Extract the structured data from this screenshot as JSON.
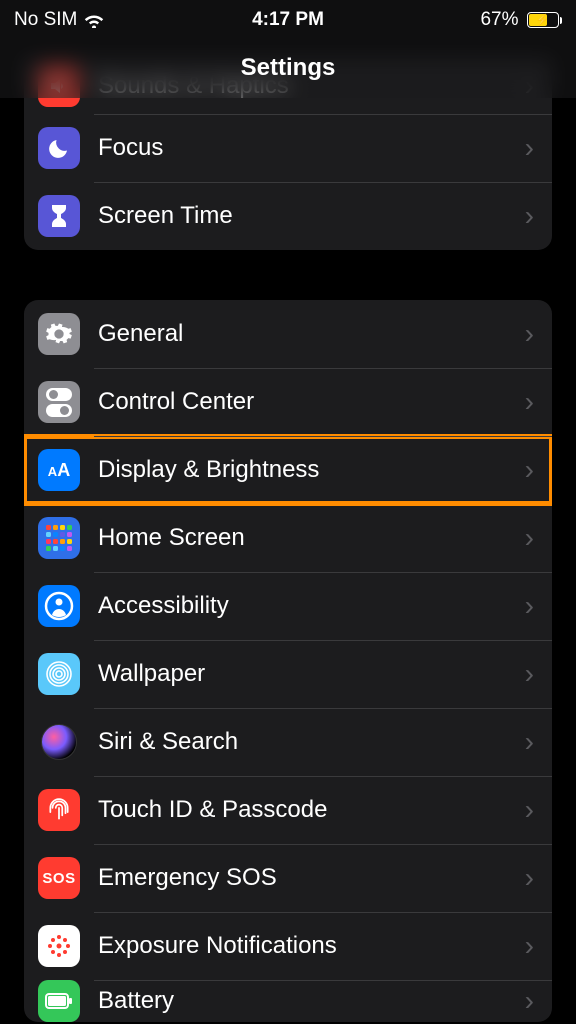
{
  "status": {
    "carrier": "No SIM",
    "time": "4:17 PM",
    "battery_pct": "67%",
    "battery_fill_pct": 67
  },
  "header": {
    "title": "Settings"
  },
  "group1": [
    {
      "label": "Sounds & Haptics",
      "icon": "speaker",
      "bg": "bg-red"
    },
    {
      "label": "Focus",
      "icon": "moon",
      "bg": "bg-indigo"
    },
    {
      "label": "Screen Time",
      "icon": "hourglass",
      "bg": "bg-indigo"
    }
  ],
  "group2": [
    {
      "label": "General",
      "icon": "gear",
      "bg": "bg-gray"
    },
    {
      "label": "Control Center",
      "icon": "toggles",
      "bg": "bg-gray"
    },
    {
      "label": "Display & Brightness",
      "icon": "aa",
      "bg": "bg-blue",
      "highlight": true
    },
    {
      "label": "Home Screen",
      "icon": "apps",
      "bg": "bg-blue2"
    },
    {
      "label": "Accessibility",
      "icon": "person",
      "bg": "bg-blue"
    },
    {
      "label": "Wallpaper",
      "icon": "flower",
      "bg": "bg-cyan"
    },
    {
      "label": "Siri & Search",
      "icon": "siri",
      "bg": "bg-black"
    },
    {
      "label": "Touch ID & Passcode",
      "icon": "fingerprint",
      "bg": "bg-red"
    },
    {
      "label": "Emergency SOS",
      "icon": "sos",
      "bg": "bg-red"
    },
    {
      "label": "Exposure Notifications",
      "icon": "covid",
      "bg": "bg-white"
    },
    {
      "label": "Battery",
      "icon": "battery",
      "bg": "bg-green"
    }
  ]
}
